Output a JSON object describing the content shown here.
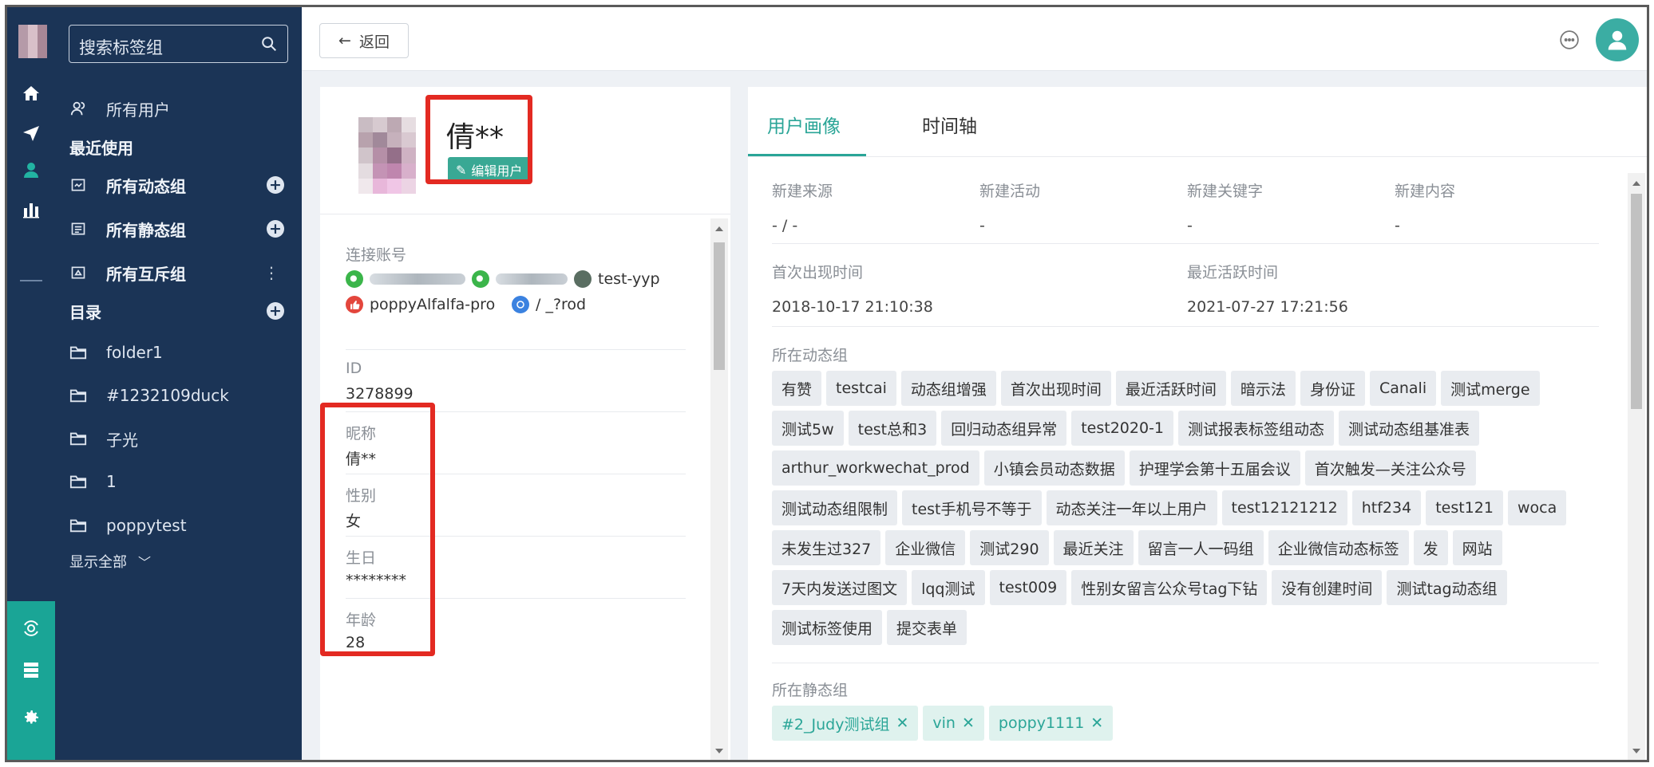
{
  "sidebar": {
    "search_placeholder": "搜索标签组",
    "all_users": "所有用户",
    "recent_header": "最近使用",
    "groups": [
      {
        "label": "所有动态组"
      },
      {
        "label": "所有静态组"
      },
      {
        "label": "所有互斥组"
      }
    ],
    "directory_header": "目录",
    "folders": [
      "folder1",
      "#1232109duck",
      "子光",
      "1",
      "poppytest"
    ],
    "show_all": "显示全部"
  },
  "topbar": {
    "back_label": "返回"
  },
  "profile": {
    "name": "倩**",
    "edit_label": "编辑用户",
    "accounts_label": "连接账号",
    "accounts": [
      {
        "type": "wechat",
        "name": ""
      },
      {
        "type": "wechat",
        "name": ""
      },
      {
        "type": "avatar",
        "name": "test-yyp"
      },
      {
        "type": "weibo",
        "name": "poppyAlfalfa-pro"
      },
      {
        "type": "chat",
        "name": "/ _?rod"
      }
    ],
    "id_label": "ID",
    "id_value": "3278899",
    "nickname_label": "昵称",
    "nickname_value": "倩**",
    "gender_label": "性别",
    "gender_value": "女",
    "birthday_label": "生日",
    "birthday_value": "********",
    "age_label": "年龄",
    "age_value": "28"
  },
  "tabs": [
    {
      "label": "用户画像",
      "active": true
    },
    {
      "label": "时间轴",
      "active": false
    }
  ],
  "portrait": {
    "fields_row1": [
      {
        "label": "新建来源",
        "value": "- / -"
      },
      {
        "label": "新建活动",
        "value": "-"
      },
      {
        "label": "新建关键字",
        "value": "-"
      },
      {
        "label": "新建内容",
        "value": "-"
      }
    ],
    "fields_row2": [
      {
        "label": "首次出现时间",
        "value": "2018-10-17 21:10:38"
      },
      {
        "label": "最近活跃时间",
        "value": "2021-07-27 17:21:56"
      }
    ],
    "dynamic_groups_label": "所在动态组",
    "dynamic_groups": [
      "有赞",
      "testcai",
      "动态组增强",
      "首次出现时间",
      "最近活跃时间",
      "暗示法",
      "身份证",
      "Canali",
      "测试merge",
      "测试5w",
      "test总和3",
      "回归动态组异常",
      "test2020-1",
      "测试报表标签组动态",
      "测试动态组基准表",
      "arthur_workwechat_prod",
      "小镇会员动态数据",
      "护理学会第十五届会议",
      "首次触发—关注公众号",
      "测试动态组限制",
      "test手机号不等于",
      "动态关注一年以上用户",
      "test12121212",
      "htf234",
      "test121",
      "woca",
      "未发生过327",
      "企业微信",
      "测试290",
      "最近关注",
      "留言一人一码组",
      "企业微信动态标签",
      "发",
      "网站",
      "7天内发送过图文",
      "lqq测试",
      "test009",
      "性别女留言公众号tag下钻",
      "没有创建时间",
      "测试tag动态组",
      "测试标签使用",
      "提交表单"
    ],
    "static_groups_label": "所在静态组",
    "static_groups": [
      "#2_Judy测试组",
      "vin",
      "poppy1111"
    ]
  },
  "colors": {
    "sidebar_bg": "#1b3456",
    "accent": "#2aa597",
    "highlight_red": "#e32a22"
  }
}
